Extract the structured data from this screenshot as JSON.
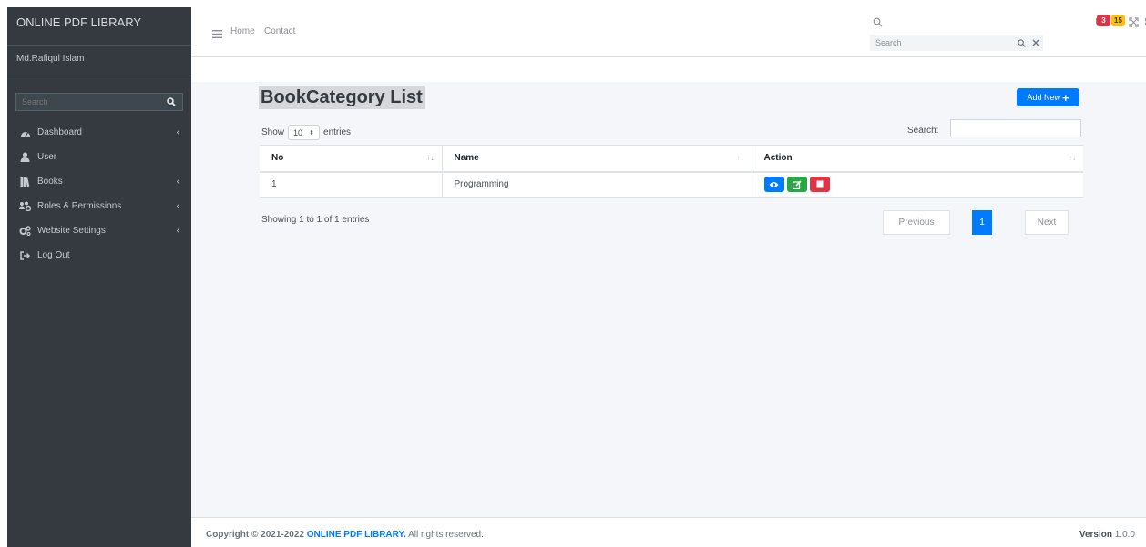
{
  "sidebar": {
    "brand": "ONLINE PDF LIBRARY",
    "user_name": "Md.Rafiqul Islam",
    "search_placeholder": "Search",
    "items": [
      {
        "label": "Dashboard",
        "icon": "dashboard-icon",
        "has_submenu": true
      },
      {
        "label": "User",
        "icon": "user-icon",
        "has_submenu": false
      },
      {
        "label": "Books",
        "icon": "books-icon",
        "has_submenu": true
      },
      {
        "label": "Roles & Permissions",
        "icon": "users-cog-icon",
        "has_submenu": true
      },
      {
        "label": "Website Settings",
        "icon": "cogs-icon",
        "has_submenu": true
      },
      {
        "label": "Log Out",
        "icon": "sign-out-icon",
        "has_submenu": false
      }
    ]
  },
  "topbar": {
    "links": [
      "Home",
      "Contact"
    ],
    "search_placeholder": "Search",
    "badges": [
      {
        "value": "3",
        "color": "#dc3545"
      },
      {
        "value": "15",
        "color": "#ffc107"
      }
    ]
  },
  "page": {
    "title": "BookCategory List",
    "add_button": "Add New"
  },
  "datatable": {
    "show_label": "Show",
    "entries_value": "10",
    "entries_label": "entries",
    "search_label": "Search:",
    "columns": [
      "No",
      "Name",
      "Action"
    ],
    "rows": [
      {
        "no": "1",
        "name": "Programming",
        "actions": [
          "view",
          "edit",
          "delete"
        ]
      }
    ],
    "info": "Showing 1 to 1 of 1 entries",
    "pagination": {
      "previous": "Previous",
      "current": "1",
      "next": "Next"
    }
  },
  "footer": {
    "copyright_prefix": "Copyright © 2021-2022",
    "brand": "ONLINE PDF LIBRARY.",
    "rights": "All rights reserved.",
    "version_label": "Version",
    "version": "1.0.0"
  },
  "colors": {
    "sidebar_bg": "#343a40",
    "primary": "#007bff",
    "success": "#28a745",
    "danger": "#dc3545",
    "warning": "#ffc107",
    "content_bg": "#f4f6f9"
  }
}
